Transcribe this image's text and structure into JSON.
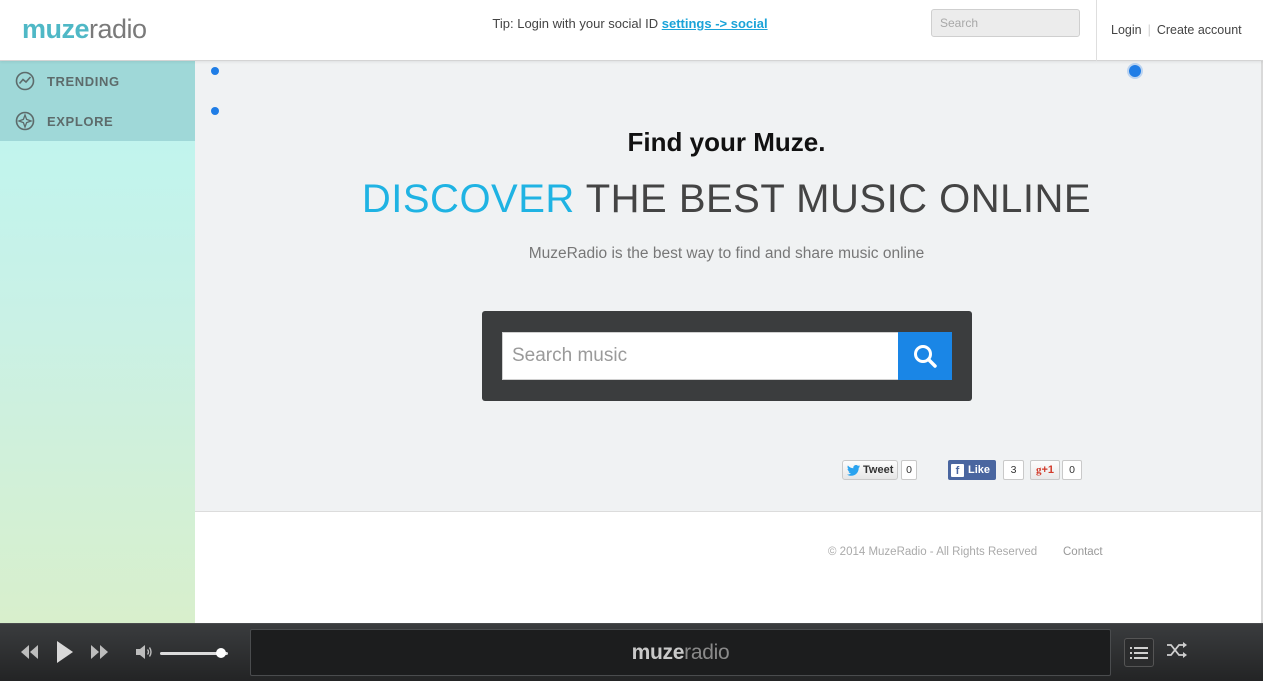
{
  "header": {
    "logo_part1": "muze",
    "logo_part2": "radio",
    "tip_text": "Tip: Login with your social ID ",
    "tip_link": "settings -> social",
    "search_placeholder": "Search",
    "login": "Login",
    "create_account": "Create account"
  },
  "sidebar": {
    "items": [
      {
        "label": "TRENDING",
        "icon": "trending-icon"
      },
      {
        "label": "EXPLORE",
        "icon": "compass-icon"
      }
    ]
  },
  "main": {
    "headline": "Find your Muze.",
    "hero_accent": "DISCOVER",
    "hero_rest": " THE BEST MUSIC ONLINE",
    "subline": "MuzeRadio is the best way to find and share music online",
    "search_placeholder": "Search music"
  },
  "social": {
    "tweet_label": "Tweet",
    "tweet_count": "0",
    "like_label": "Like",
    "like_count": "3",
    "gplus_label": "+1",
    "gplus_count": "0"
  },
  "footer": {
    "copyright": "© 2014 MuzeRadio - All Rights Reserved",
    "contact": "Contact"
  },
  "player": {
    "display_logo_part1": "muze",
    "display_logo_part2": "radio",
    "volume": 0.9
  },
  "colors": {
    "accent": "#1fb3e3",
    "search_button": "#1a86e6",
    "sidebar_nav": "#9fd8d8",
    "logo_teal": "#4fb8c6"
  }
}
